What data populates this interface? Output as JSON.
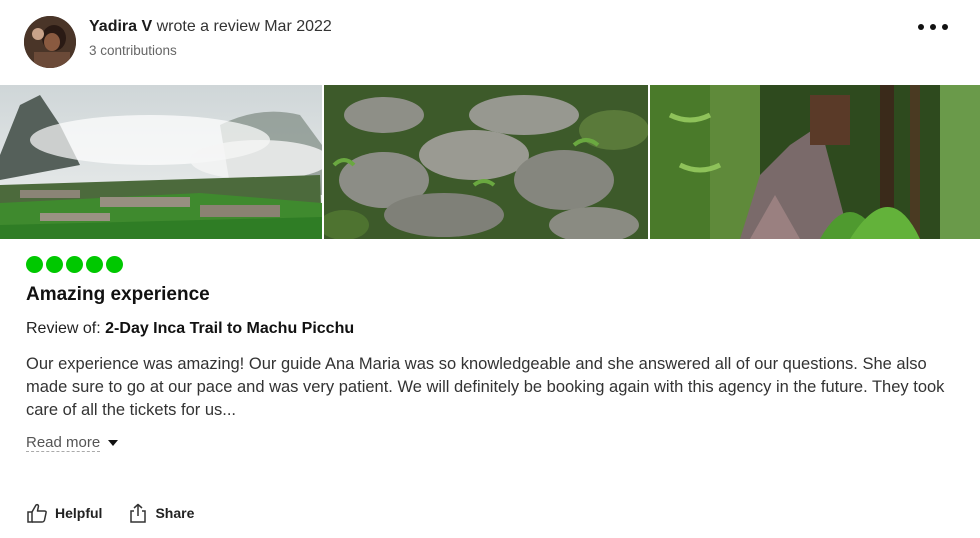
{
  "review": {
    "author": "Yadira V",
    "action_text": "wrote a review",
    "date": "Mar 2022",
    "contributions": "3 contributions",
    "rating_bubbles": 5,
    "title": "Amazing experience",
    "review_of_label": "Review of:",
    "tour_name": "2-Day Inca Trail to Machu Picchu",
    "text": "Our experience was amazing! Our guide Ana Maria was so knowledgeable and she answered all of our questions. She also made sure to go at our pace and was very patient. We will definitely be booking again with this agency in the future. They took care of all the tickets for us...",
    "read_more": "Read more"
  },
  "actions": {
    "helpful": "Helpful",
    "share": "Share"
  },
  "icons": {
    "more": "more-options-icon",
    "helpful": "thumbs-up-icon",
    "share": "share-icon",
    "caret": "caret-down-icon"
  },
  "colors": {
    "rating": "#00c800",
    "text": "#333333"
  }
}
